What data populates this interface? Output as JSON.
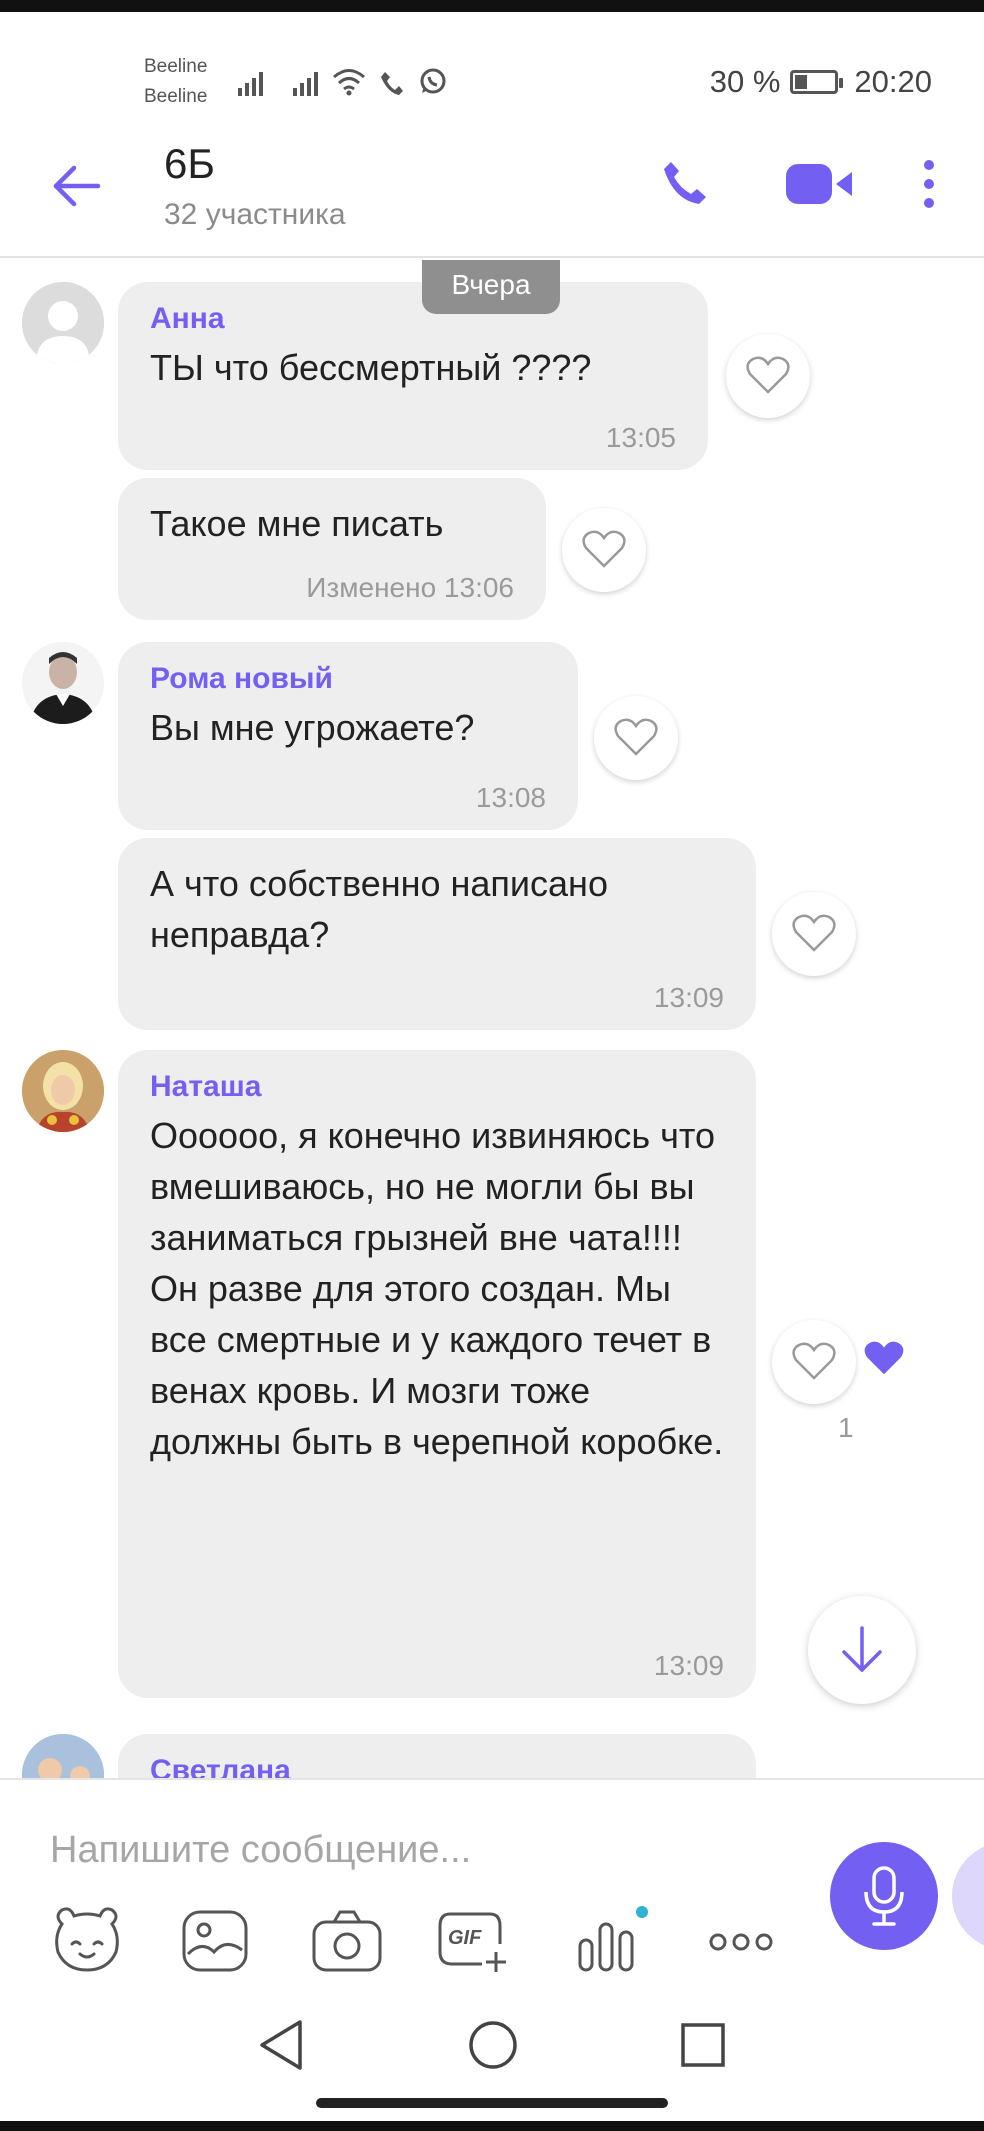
{
  "status_bar": {
    "carrier1": "Beeline",
    "carrier2": "Beeline",
    "battery": "30 %",
    "battery_level": 0.3,
    "time": "20:20",
    "icons": [
      "signal-icon",
      "signal-icon",
      "wifi-icon",
      "phone-call-icon",
      "whatsapp-icon"
    ]
  },
  "header": {
    "title": "6Б",
    "subtitle": "32 участника",
    "icons": [
      "back-arrow-icon",
      "phone-icon",
      "video-icon",
      "more-vertical-icon"
    ]
  },
  "date_chip": "Вчера",
  "messages": [
    {
      "sender": "Анна",
      "text": "ТЫ что бессмертный ????",
      "time": "13:05"
    },
    {
      "text": "Такое мне писать",
      "time": "Изменено  13:06"
    },
    {
      "sender": "Рома новый",
      "text": "Вы мне угрожаете?",
      "time": "13:08"
    },
    {
      "text": "А что собственно написано неправда?",
      "time": "13:09"
    },
    {
      "sender": "Наташа",
      "text": "Оооооо, я конечно извиняюсь что вмешиваюсь, но не могли бы вы заниматься грызней вне чата!!!! Он разве для этого создан. Мы все смертные и у каждого течет в венах кровь. И мозги тоже должны быть в черепной коробке.",
      "time": "13:09",
      "likes": "1"
    },
    {
      "sender": "Светлана"
    }
  ],
  "composer": {
    "placeholder": "Напишите сообщение...",
    "tools": [
      "sticker-icon",
      "gallery-icon",
      "camera-icon",
      "gif-icon",
      "poll-icon",
      "more-horizontal-icon"
    ],
    "gif_label": "GIF"
  },
  "colors": {
    "accent": "#7360f2",
    "bubble": "#eeeeee",
    "timestamp": "#9a9a9a"
  }
}
